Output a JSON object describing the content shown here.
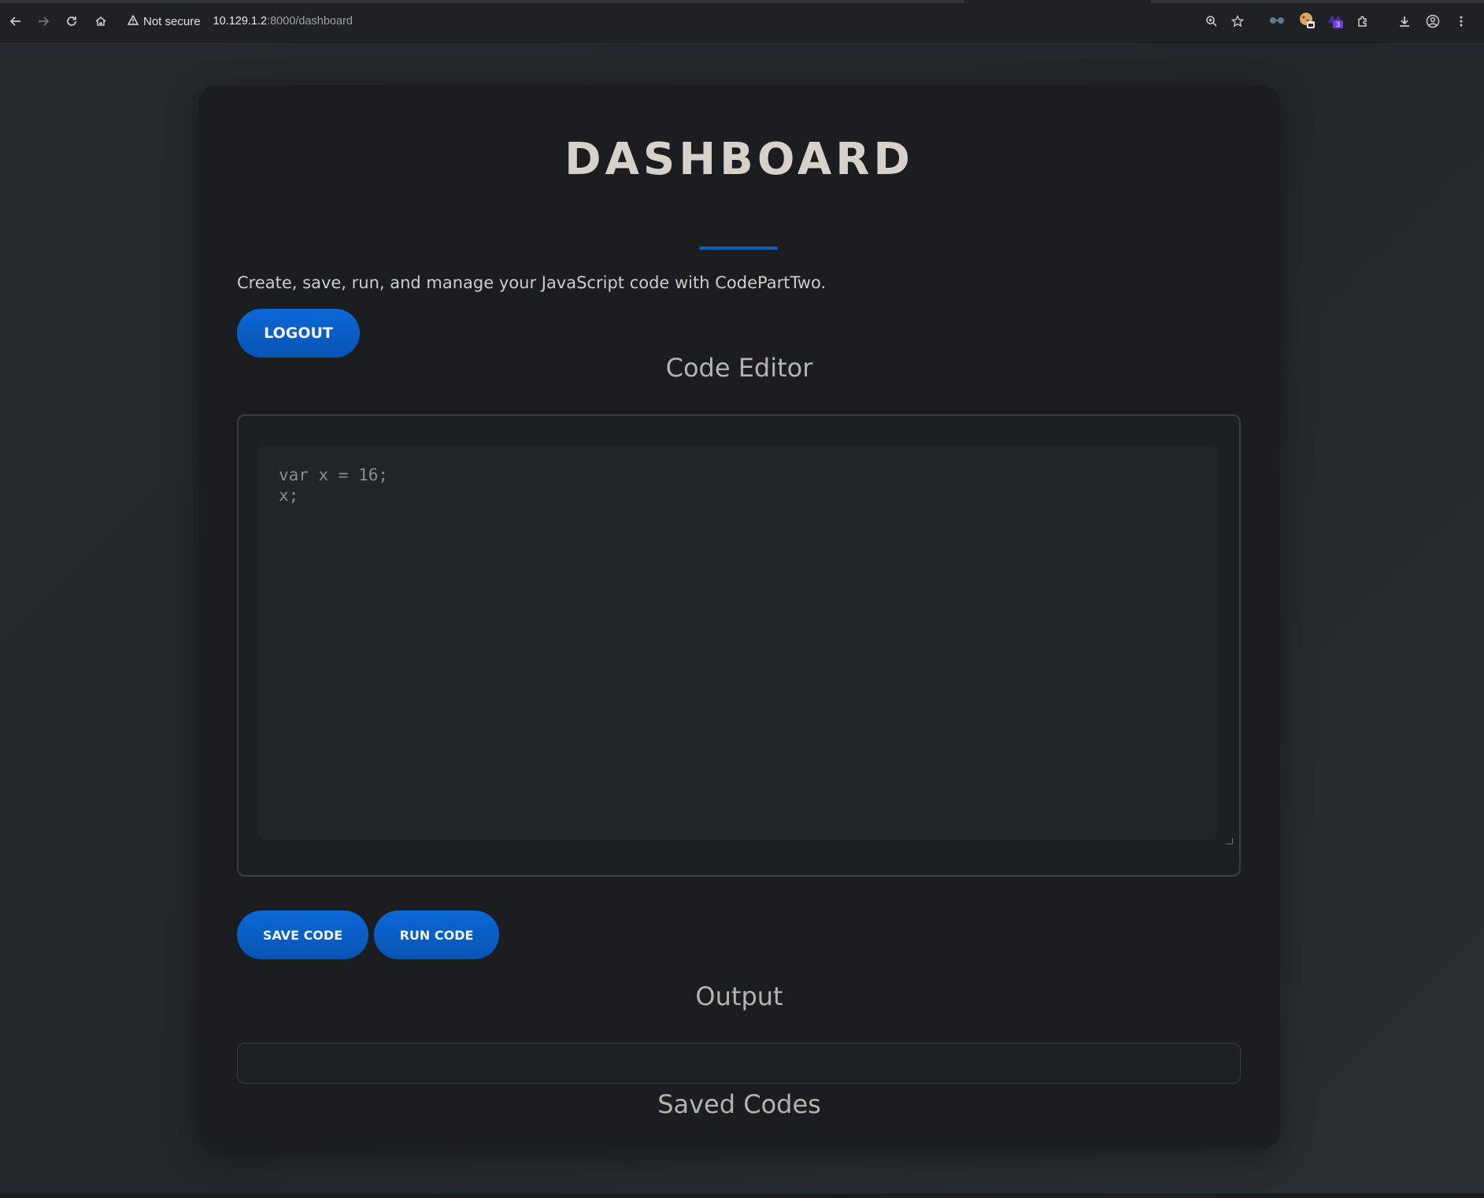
{
  "browser": {
    "security_label": "Not secure",
    "url_host": "10.129.1.2",
    "url_path": ":8000/dashboard",
    "extension_badge": "3"
  },
  "page": {
    "title": "DASHBOARD",
    "description": "Create, save, run, and manage your JavaScript code with CodePartTwo.",
    "logout_label": "LOGOUT",
    "code_editor_heading": "Code Editor",
    "code_content": "var x = 16;\nx;",
    "save_label": "SAVE CODE",
    "run_label": "RUN CODE",
    "output_heading": "Output",
    "output_value": "",
    "saved_codes_heading": "Saved Codes"
  },
  "colors": {
    "accent_blue": "#0a5fc2",
    "card_bg": "#1b1d20",
    "page_bg": "#24282c"
  },
  "icons": [
    "back-icon",
    "forward-icon",
    "reload-icon",
    "home-icon",
    "warning-icon",
    "zoom-icon",
    "star-icon",
    "extension-icon",
    "download-icon",
    "profile-icon",
    "menu-icon"
  ]
}
